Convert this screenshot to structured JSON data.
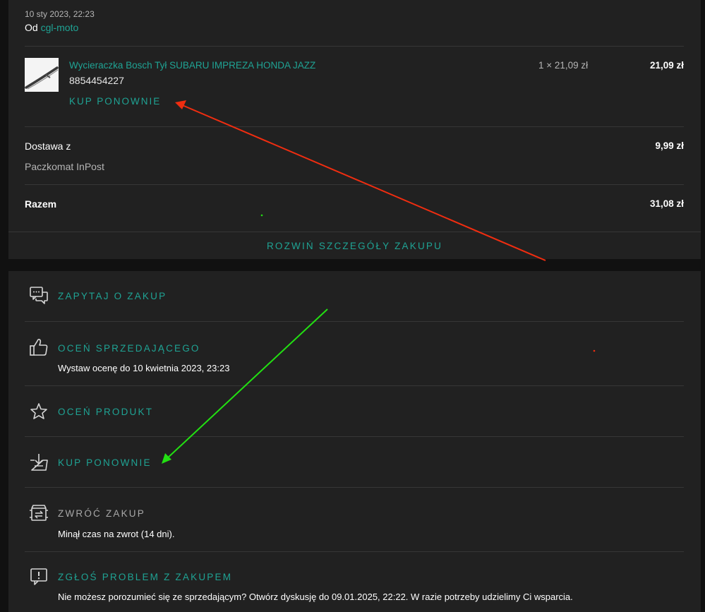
{
  "order": {
    "date": "10 sty 2023, 22:23",
    "seller_prefix": "Od",
    "seller_name": "cgl-moto",
    "item": {
      "title": "Wycieraczka Bosch Tył SUBARU IMPREZA HONDA JAZZ",
      "id": "8854454227",
      "qty_price": "1 × 21,09 zł",
      "total": "21,09 zł",
      "buy_again": "KUP PONOWNIE"
    },
    "delivery": {
      "label": "Dostawa z",
      "method": "Paczkomat InPost",
      "price": "9,99 zł"
    },
    "summary": {
      "label": "Razem",
      "price": "31,08 zł"
    },
    "expand_label": "ROZWIŃ SZCZEGÓŁY ZAKUPU"
  },
  "actions": [
    {
      "icon": "chat-icon",
      "label": "ZAPYTAJ O ZAKUP",
      "sub": ""
    },
    {
      "icon": "thumbs-up-icon",
      "label": "OCEŃ SPRZEDAJĄCEGO",
      "sub": "Wystaw ocenę do 10 kwietnia 2023, 23:23"
    },
    {
      "icon": "star-icon",
      "label": "OCEŃ PRODUKT",
      "sub": ""
    },
    {
      "icon": "basket-download-icon",
      "label": "KUP PONOWNIE",
      "sub": ""
    },
    {
      "icon": "return-box-icon",
      "label": "ZWRÓĆ ZAKUP",
      "sub": "Minął czas na zwrot (14 dni)."
    },
    {
      "icon": "report-problem-icon",
      "label": "ZGŁOŚ PROBLEM Z ZAKUPEM",
      "sub": "Nie możesz porozumieć się ze sprzedającym? Otwórz dyskusję do 09.01.2025, 22:22. W razie potrzeby udzielimy Ci wsparcia."
    }
  ],
  "colors": {
    "accent": "#1fa394",
    "red_arrow": "#f02d10",
    "green_arrow": "#22e012"
  }
}
